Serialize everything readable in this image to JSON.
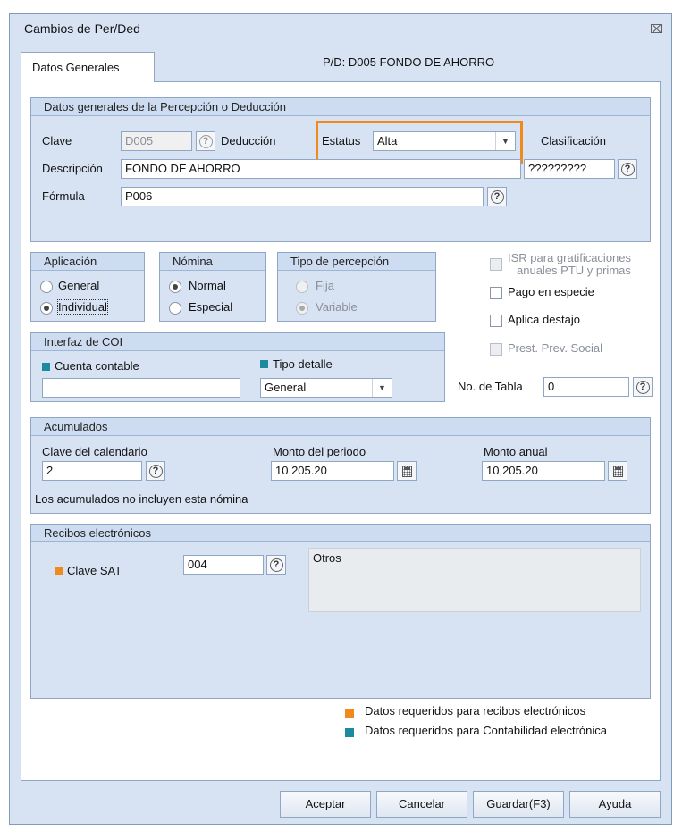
{
  "window": {
    "title": "Cambios de Per/Ded",
    "close": "⌧"
  },
  "tab": {
    "label": "Datos Generales"
  },
  "header": {
    "pd": "P/D: D005  FONDO DE AHORRO"
  },
  "datos_generales": {
    "title": "Datos generales de la Percepción o Deducción",
    "clave_label": "Clave",
    "clave_value": "D005",
    "tipo_label": "Deducción",
    "estatus_label": "Estatus",
    "estatus_value": "Alta",
    "clasificacion_label": "Clasificación",
    "clasificacion_value": "?????????",
    "descripcion_label": "Descripción",
    "descripcion_value": "FONDO DE AHORRO",
    "formula_label": "Fórmula",
    "formula_value": "P006"
  },
  "aplicacion": {
    "title": "Aplicación",
    "general": "General",
    "individual": "Individual",
    "selected": "Individual"
  },
  "nomina": {
    "title": "Nómina",
    "normal": "Normal",
    "especial": "Especial",
    "selected": "Normal"
  },
  "tipo_percepcion": {
    "title": "Tipo de percepción",
    "fija": "Fija",
    "variable": "Variable",
    "selected": "Variable"
  },
  "options": {
    "isr_line1": "ISR para gratificaciones",
    "isr_line2": "anuales PTU y primas",
    "pago_especie": "Pago en especie",
    "aplica_destajo": "Aplica destajo",
    "prest_prev": "Prest. Prev. Social",
    "no_tabla_label": "No. de Tabla",
    "no_tabla_value": "0"
  },
  "coi": {
    "title": "Interfaz de COI",
    "cuenta_label": "Cuenta contable",
    "cuenta_value": "",
    "tipo_detalle_label": "Tipo detalle",
    "tipo_detalle_value": "General"
  },
  "acumulados": {
    "title": "Acumulados",
    "clave_cal_label": "Clave del calendario",
    "clave_cal_value": "2",
    "monto_periodo_label": "Monto del periodo",
    "monto_periodo_value": "10,205.20",
    "monto_anual_label": "Monto anual",
    "monto_anual_value": "10,205.20",
    "note": "Los acumulados no incluyen esta nómina"
  },
  "recibos": {
    "title": "Recibos electrónicos",
    "clave_sat_label": "Clave SAT",
    "clave_sat_value": "004",
    "desc_value": "Otros"
  },
  "legend": {
    "orange": "Datos requeridos para recibos electrónicos",
    "teal": "Datos requeridos para Contabilidad electrónica"
  },
  "colors": {
    "orange": "#f08a1c",
    "teal": "#1b8a9c",
    "highlight": "#f08a1c"
  },
  "buttons": {
    "aceptar": "Aceptar",
    "cancelar": "Cancelar",
    "guardar": "Guardar(F3)",
    "ayuda": "Ayuda"
  }
}
